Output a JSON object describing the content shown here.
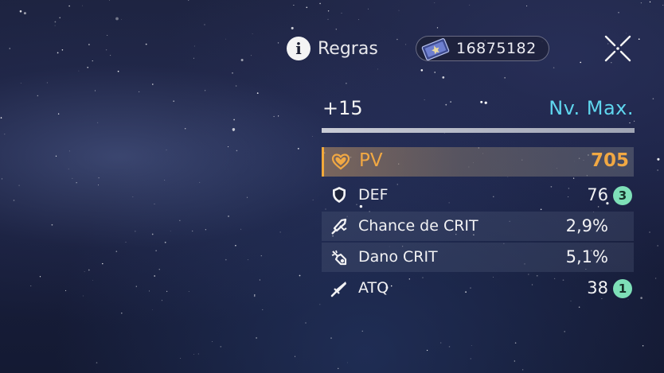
{
  "header": {
    "rules_label": "Regras",
    "currency_icon": "star-rail-pass-icon",
    "currency_value": "16875182",
    "close_icon": "close-icon"
  },
  "level": {
    "current": "+15",
    "status": "Nv. Max."
  },
  "main_stat": {
    "icon": "heart-icon",
    "name": "PV",
    "value": "705",
    "color": "#f1a843"
  },
  "sub_stats": [
    {
      "icon": "shield-icon",
      "name": "DEF",
      "value": "76",
      "rolls": "3"
    },
    {
      "icon": "crit-rate-icon",
      "name": "Chance de CRIT",
      "value": "2,9%",
      "rolls": ""
    },
    {
      "icon": "crit-damage-icon",
      "name": "Dano CRIT",
      "value": "5,1%",
      "rolls": ""
    },
    {
      "icon": "sword-icon",
      "name": "ATQ",
      "value": "38",
      "rolls": "1"
    }
  ],
  "colors": {
    "accent_cyan": "#5fd6ee",
    "roll_badge": "#7ee0b8"
  }
}
